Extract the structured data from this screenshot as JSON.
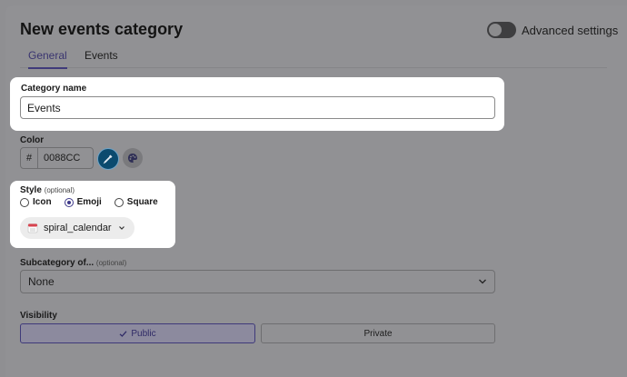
{
  "header": {
    "title": "New events category",
    "advanced_label": "Advanced settings",
    "advanced_enabled": false
  },
  "tabs": [
    {
      "label": "General",
      "active": true
    },
    {
      "label": "Events",
      "active": false
    }
  ],
  "form": {
    "category_name": {
      "label": "Category name",
      "value": "Events"
    },
    "color": {
      "label": "Color",
      "prefix": "#",
      "value": "0088CC",
      "swatch": "#0088CC"
    },
    "style": {
      "label": "Style",
      "optional": "(optional)",
      "options": [
        {
          "label": "Icon",
          "selected": false
        },
        {
          "label": "Emoji",
          "selected": true
        },
        {
          "label": "Square",
          "selected": false
        }
      ],
      "emoji_value": "spiral_calendar"
    },
    "subcategory": {
      "label": "Subcategory of...",
      "optional": "(optional)",
      "value": "None"
    },
    "visibility": {
      "label": "Visibility",
      "options": [
        {
          "label": "Public",
          "selected": true
        },
        {
          "label": "Private",
          "selected": false
        }
      ]
    }
  },
  "colors": {
    "accent": "#3f3a7a",
    "highlight": "#ffffff"
  }
}
